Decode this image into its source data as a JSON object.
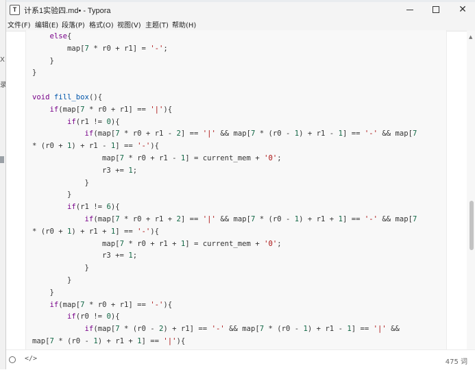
{
  "window": {
    "title": "计系1实验四.md• - Typora",
    "app_icon": "T",
    "controls": [
      "minimize-icon",
      "maximize-icon",
      "close-icon"
    ],
    "close_glyph": "✕"
  },
  "left_strip": {
    "glyphs": [
      "X",
      "录"
    ]
  },
  "menu": {
    "items": [
      "文件(F)",
      "编辑(E)",
      "段落(P)",
      "格式(O)",
      "视图(V)",
      "主题(T)",
      "帮助(H)"
    ]
  },
  "code": {
    "lines": [
      [
        [
          "p",
          "    "
        ],
        [
          "k",
          "else"
        ],
        [
          "p",
          "{"
        ]
      ],
      [
        [
          "p",
          "        map["
        ],
        [
          "n",
          "7"
        ],
        [
          "p",
          " * r0 + r1] = "
        ],
        [
          "s",
          "'-'"
        ],
        [
          "p",
          ";"
        ]
      ],
      [
        [
          "p",
          "    }"
        ]
      ],
      [
        [
          "p",
          "}"
        ]
      ],
      [
        [
          "p",
          ""
        ]
      ],
      [
        [
          "k",
          "void"
        ],
        [
          "p",
          " "
        ],
        [
          "d",
          "fill_box"
        ],
        [
          "p",
          "(){"
        ]
      ],
      [
        [
          "p",
          "    "
        ],
        [
          "k",
          "if"
        ],
        [
          "p",
          "(map["
        ],
        [
          "n",
          "7"
        ],
        [
          "p",
          " * r0 + r1] == "
        ],
        [
          "s",
          "'|'"
        ],
        [
          "p",
          "){"
        ]
      ],
      [
        [
          "p",
          "        "
        ],
        [
          "k",
          "if"
        ],
        [
          "p",
          "(r1 != "
        ],
        [
          "n",
          "0"
        ],
        [
          "p",
          "){"
        ]
      ],
      [
        [
          "p",
          "            "
        ],
        [
          "k",
          "if"
        ],
        [
          "p",
          "(map["
        ],
        [
          "n",
          "7"
        ],
        [
          "p",
          " * r0 + r1 - "
        ],
        [
          "n",
          "2"
        ],
        [
          "p",
          "] == "
        ],
        [
          "s",
          "'|'"
        ],
        [
          "p",
          " && map["
        ],
        [
          "n",
          "7"
        ],
        [
          "p",
          " * (r0 - "
        ],
        [
          "n",
          "1"
        ],
        [
          "p",
          ") + r1 - "
        ],
        [
          "n",
          "1"
        ],
        [
          "p",
          "] == "
        ],
        [
          "s",
          "'-'"
        ],
        [
          "p",
          " && map["
        ],
        [
          "n",
          "7"
        ]
      ],
      [
        [
          "p",
          "* (r0 + "
        ],
        [
          "n",
          "1"
        ],
        [
          "p",
          ") + r1 - "
        ],
        [
          "n",
          "1"
        ],
        [
          "p",
          "] == "
        ],
        [
          "s",
          "'-'"
        ],
        [
          "p",
          "){"
        ]
      ],
      [
        [
          "p",
          "                map["
        ],
        [
          "n",
          "7"
        ],
        [
          "p",
          " * r0 + r1 - "
        ],
        [
          "n",
          "1"
        ],
        [
          "p",
          "] = current_mem + "
        ],
        [
          "s",
          "'0'"
        ],
        [
          "p",
          ";"
        ]
      ],
      [
        [
          "p",
          "                r3 += "
        ],
        [
          "n",
          "1"
        ],
        [
          "p",
          ";"
        ]
      ],
      [
        [
          "p",
          "            }"
        ]
      ],
      [
        [
          "p",
          "        }"
        ]
      ],
      [
        [
          "p",
          "        "
        ],
        [
          "k",
          "if"
        ],
        [
          "p",
          "(r1 != "
        ],
        [
          "n",
          "6"
        ],
        [
          "p",
          "){"
        ]
      ],
      [
        [
          "p",
          "            "
        ],
        [
          "k",
          "if"
        ],
        [
          "p",
          "(map["
        ],
        [
          "n",
          "7"
        ],
        [
          "p",
          " * r0 + r1 + "
        ],
        [
          "n",
          "2"
        ],
        [
          "p",
          "] == "
        ],
        [
          "s",
          "'|'"
        ],
        [
          "p",
          " && map["
        ],
        [
          "n",
          "7"
        ],
        [
          "p",
          " * (r0 - "
        ],
        [
          "n",
          "1"
        ],
        [
          "p",
          ") + r1 + "
        ],
        [
          "n",
          "1"
        ],
        [
          "p",
          "] == "
        ],
        [
          "s",
          "'-'"
        ],
        [
          "p",
          " && map["
        ],
        [
          "n",
          "7"
        ]
      ],
      [
        [
          "p",
          "* (r0 + "
        ],
        [
          "n",
          "1"
        ],
        [
          "p",
          ") + r1 + "
        ],
        [
          "n",
          "1"
        ],
        [
          "p",
          "] == "
        ],
        [
          "s",
          "'-'"
        ],
        [
          "p",
          "){"
        ]
      ],
      [
        [
          "p",
          "                map["
        ],
        [
          "n",
          "7"
        ],
        [
          "p",
          " * r0 + r1 + "
        ],
        [
          "n",
          "1"
        ],
        [
          "p",
          "] = current_mem + "
        ],
        [
          "s",
          "'0'"
        ],
        [
          "p",
          ";"
        ]
      ],
      [
        [
          "p",
          "                r3 += "
        ],
        [
          "n",
          "1"
        ],
        [
          "p",
          ";"
        ]
      ],
      [
        [
          "p",
          "            }"
        ]
      ],
      [
        [
          "p",
          "        }"
        ]
      ],
      [
        [
          "p",
          "    }"
        ]
      ],
      [
        [
          "p",
          "    "
        ],
        [
          "k",
          "if"
        ],
        [
          "p",
          "(map["
        ],
        [
          "n",
          "7"
        ],
        [
          "p",
          " * r0 + r1] == "
        ],
        [
          "s",
          "'-'"
        ],
        [
          "p",
          "){"
        ]
      ],
      [
        [
          "p",
          "        "
        ],
        [
          "k",
          "if"
        ],
        [
          "p",
          "(r0 != "
        ],
        [
          "n",
          "0"
        ],
        [
          "p",
          "){"
        ]
      ],
      [
        [
          "p",
          "            "
        ],
        [
          "k",
          "if"
        ],
        [
          "p",
          "(map["
        ],
        [
          "n",
          "7"
        ],
        [
          "p",
          " * (r0 - "
        ],
        [
          "n",
          "2"
        ],
        [
          "p",
          ") + r1] == "
        ],
        [
          "s",
          "'-'"
        ],
        [
          "p",
          " && map["
        ],
        [
          "n",
          "7"
        ],
        [
          "p",
          " * (r0 - "
        ],
        [
          "n",
          "1"
        ],
        [
          "p",
          ") + r1 - "
        ],
        [
          "n",
          "1"
        ],
        [
          "p",
          "] == "
        ],
        [
          "s",
          "'|'"
        ],
        [
          "p",
          " &&"
        ]
      ],
      [
        [
          "p",
          "map["
        ],
        [
          "n",
          "7"
        ],
        [
          "p",
          " * (r0 - "
        ],
        [
          "n",
          "1"
        ],
        [
          "p",
          ") + r1 + "
        ],
        [
          "n",
          "1"
        ],
        [
          "p",
          "] == "
        ],
        [
          "s",
          "'|'"
        ],
        [
          "p",
          "){"
        ]
      ]
    ],
    "colors": {
      "keyword": "#770088",
      "def": "#0055aa",
      "number": "#116644",
      "string": "#aa1111",
      "plain": "#333333",
      "code_bg": "#f8f8f8"
    }
  },
  "status": {
    "left_icon": "circle-outline-icon",
    "source_toggle": "</>",
    "word_count": "475 词"
  }
}
